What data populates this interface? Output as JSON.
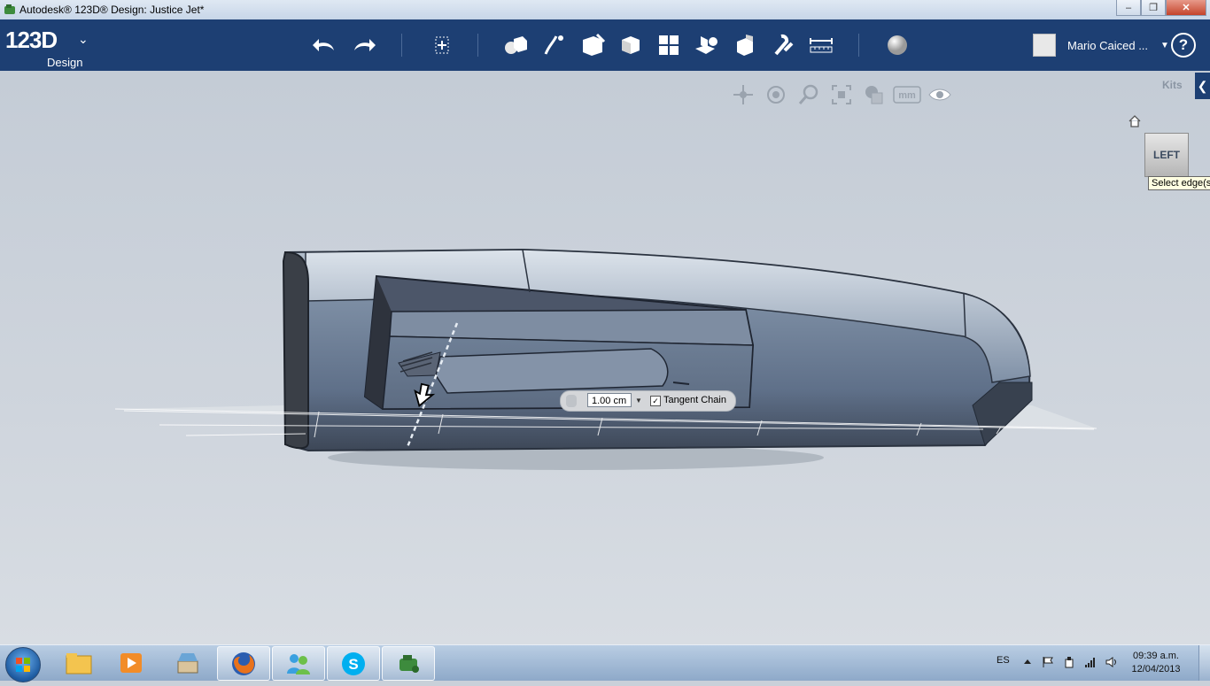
{
  "window": {
    "title": "Autodesk® 123D® Design: Justice Jet*",
    "minimize": "–",
    "maximize": "❐",
    "close": "✕"
  },
  "app": {
    "logo_main": "123D",
    "logo_sub": "Design",
    "user_name": "Mario Caiced ...",
    "help": "?"
  },
  "toolbar": {
    "icons": [
      "undo-icon",
      "redo-icon",
      "transform-icon",
      "primitives-icon",
      "sketch-icon",
      "construct-icon",
      "modify-icon",
      "pattern-icon",
      "group-icon",
      "combine-icon",
      "snap-icon",
      "measure-icon",
      "material-icon"
    ]
  },
  "viewport": {
    "kits_label": "Kits",
    "kits_arrow": "❮",
    "viewcube_face": "LEFT",
    "tooltip": "Select edge(s)",
    "units_label": "mm"
  },
  "fillet": {
    "value": "1.00 cm",
    "tangent_chain_checked": true,
    "check_mark": "✓",
    "tangent_chain_label": "Tangent Chain"
  },
  "taskbar": {
    "language": "ES",
    "time": "09:39 a.m.",
    "date": "12/04/2013",
    "tasks": [
      "explorer",
      "media-player",
      "windows-store",
      "firefox",
      "messenger",
      "skype",
      "123d-design"
    ]
  }
}
